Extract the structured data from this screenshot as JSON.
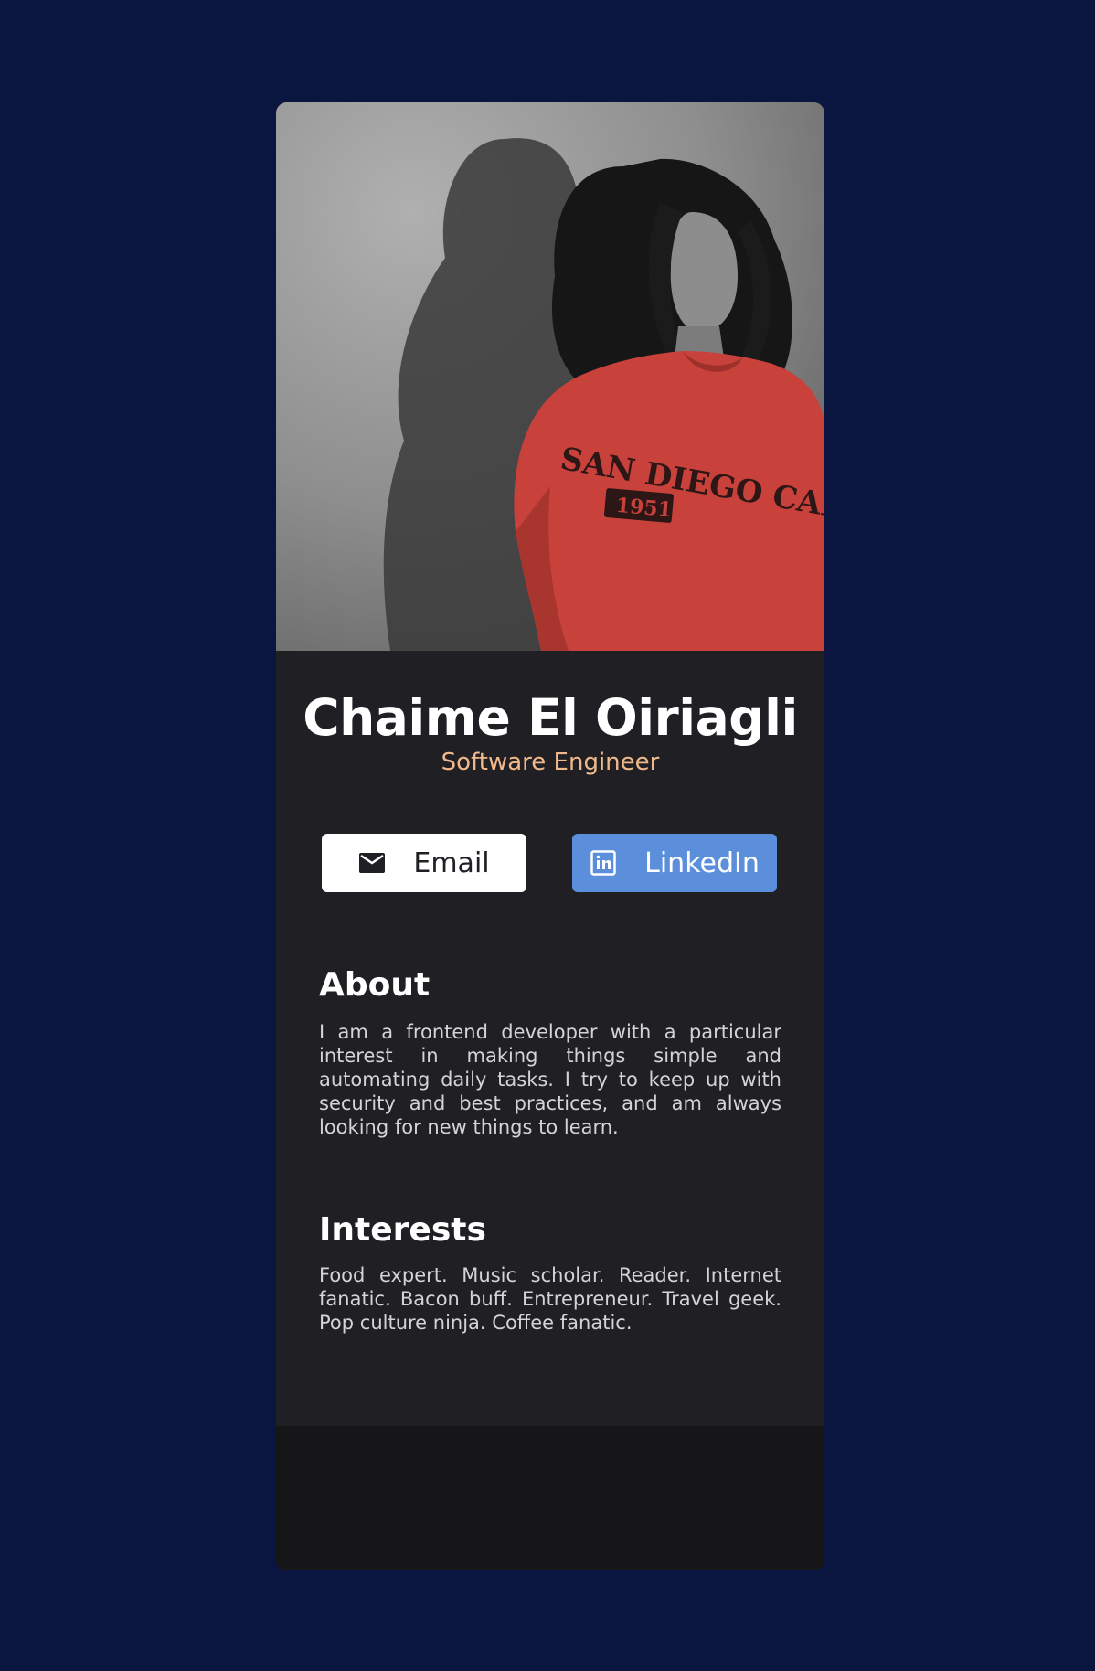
{
  "profile": {
    "name": "Chaime El Oiriagli",
    "role": "Software Engineer",
    "photo_alt": "Profile photo"
  },
  "buttons": {
    "email_label": "Email",
    "linkedin_label": "LinkedIn"
  },
  "about": {
    "title": "About",
    "text": "I am a frontend developer with a particular interest in making things simple and automating daily tasks. I try to keep up with security and best practices, and am always looking for new things to learn."
  },
  "interests": {
    "title": "Interests",
    "text": "Food expert. Music scholar. Reader. Internet fanatic. Bacon buff. Entrepreneur. Travel geek. Pop culture ninja. Coffee fanatic."
  },
  "social": {
    "icons": [
      "twitter-icon",
      "instagram-icon",
      "github-icon"
    ]
  },
  "colors": {
    "page_background": "#0b1640",
    "card_background": "#1f1f24",
    "footer_background": "#161619",
    "role_accent": "#f0b98a",
    "linkedin_button": "#5b8fdb",
    "email_button": "#ffffff"
  }
}
